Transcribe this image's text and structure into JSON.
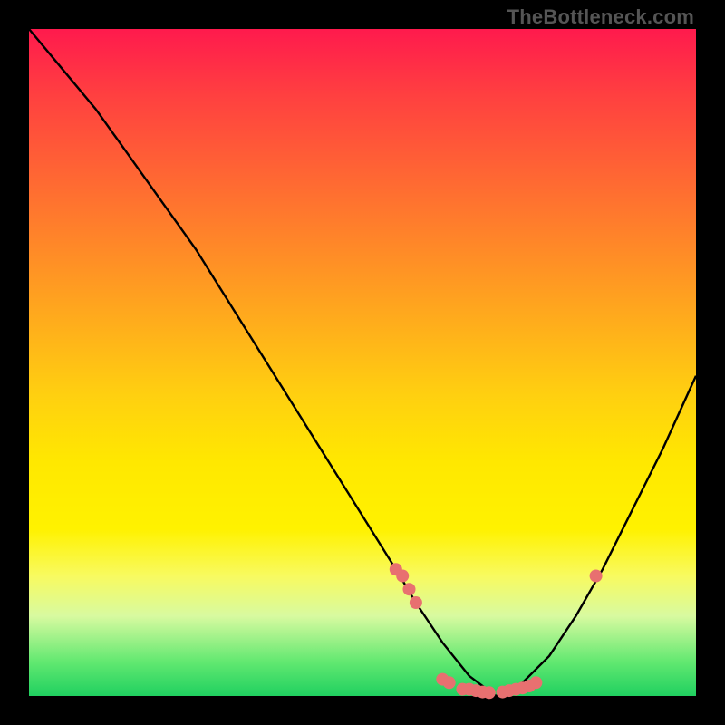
{
  "watermark": "TheBottleneck.com",
  "colors": {
    "curve": "#000000",
    "marker": "#e87070",
    "bg_top": "#ff1a4d",
    "bg_mid": "#ffe800",
    "bg_bottom": "#20d060"
  },
  "chart_data": {
    "type": "line",
    "title": "",
    "xlabel": "",
    "ylabel": "",
    "xlim": [
      0,
      100
    ],
    "ylim": [
      0,
      100
    ],
    "note": "x = normalized horizontal position (0-100 left→right); y = bottleneck % (0 at bottom/green, 100 at top/red). Curve is a V shape: steep descent then ascent, min near x≈70.",
    "series": [
      {
        "name": "bottleneck-curve",
        "x": [
          0,
          5,
          10,
          15,
          20,
          25,
          30,
          35,
          40,
          45,
          50,
          55,
          58,
          62,
          66,
          70,
          74,
          78,
          82,
          86,
          90,
          95,
          100
        ],
        "y": [
          100,
          94,
          88,
          81,
          74,
          67,
          59,
          51,
          43,
          35,
          27,
          19,
          14,
          8,
          3,
          0,
          2,
          6,
          12,
          19,
          27,
          37,
          48
        ]
      }
    ],
    "markers": {
      "name": "highlighted-points",
      "note": "salmon points clustered on the descending wall, the valley floor, and one on the ascending wall",
      "x": [
        55,
        56,
        57,
        58,
        62,
        63,
        65,
        66,
        67,
        68,
        69,
        71,
        72,
        73,
        74,
        75,
        76,
        85
      ],
      "y": [
        19,
        18,
        16,
        14,
        2.5,
        2,
        1,
        1,
        0.8,
        0.6,
        0.5,
        0.6,
        0.8,
        1,
        1.2,
        1.5,
        2,
        18
      ]
    }
  }
}
